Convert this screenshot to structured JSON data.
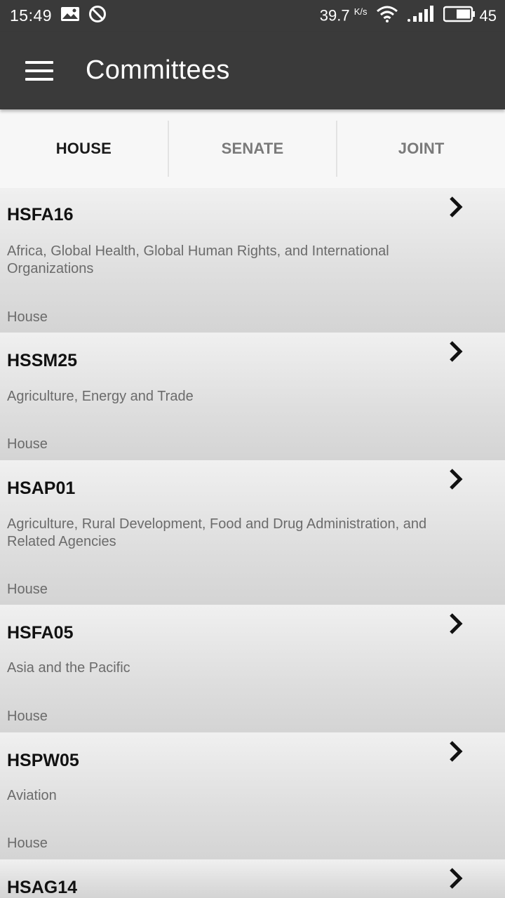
{
  "status_bar": {
    "time": "15:49",
    "speed_value": "39.7",
    "speed_unit": "K/s",
    "battery_level": "45"
  },
  "app_bar": {
    "title": "Committees",
    "menu_icon": "hamburger-menu-icon"
  },
  "tabs": [
    {
      "label": "HOUSE",
      "selected": true
    },
    {
      "label": "SENATE",
      "selected": false
    },
    {
      "label": "JOINT",
      "selected": false
    }
  ],
  "committees": [
    {
      "code": "HSFA16",
      "name": "Africa, Global Health, Global Human Rights, and International Organizations",
      "chamber": "House"
    },
    {
      "code": "HSSM25",
      "name": "Agriculture, Energy and Trade",
      "chamber": "House"
    },
    {
      "code": "HSAP01",
      "name": "Agriculture, Rural Development, Food and Drug Administration, and Related Agencies",
      "chamber": "House"
    },
    {
      "code": "HSFA05",
      "name": "Asia and the Pacific",
      "chamber": "House"
    },
    {
      "code": "HSPW05",
      "name": "Aviation",
      "chamber": "House"
    },
    {
      "code": "HSAG14",
      "name": "",
      "chamber": ""
    }
  ],
  "colors": {
    "app_bar": "#3a3a3a",
    "tab_active": "#1a1a1a",
    "tab_inactive": "#7a7a7a"
  }
}
